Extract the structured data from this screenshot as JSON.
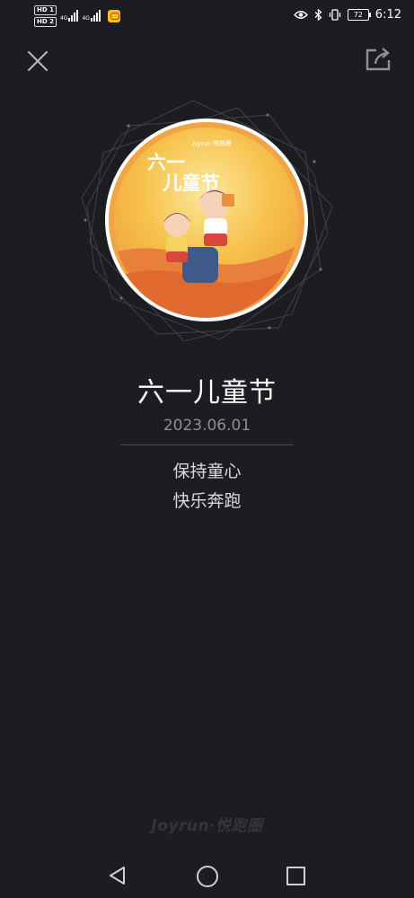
{
  "status_bar": {
    "hd_badge_1": "HD 1",
    "hd_badge_2": "HD 2",
    "network_1": "4G",
    "network_2": "4G",
    "battery": "72",
    "time": "6:12"
  },
  "medal": {
    "brand": "Joyrun 悦跑圈",
    "text": "六一儿童节",
    "line_1": "六一",
    "line_2": "儿童节",
    "accent_color": "#f4b93a",
    "rim_color": "#e87f3a"
  },
  "title": "六一儿童节",
  "date": "2023.06.01",
  "description": [
    "保持童心",
    "快乐奔跑"
  ],
  "watermark": "Joyrun·悦跑圈"
}
